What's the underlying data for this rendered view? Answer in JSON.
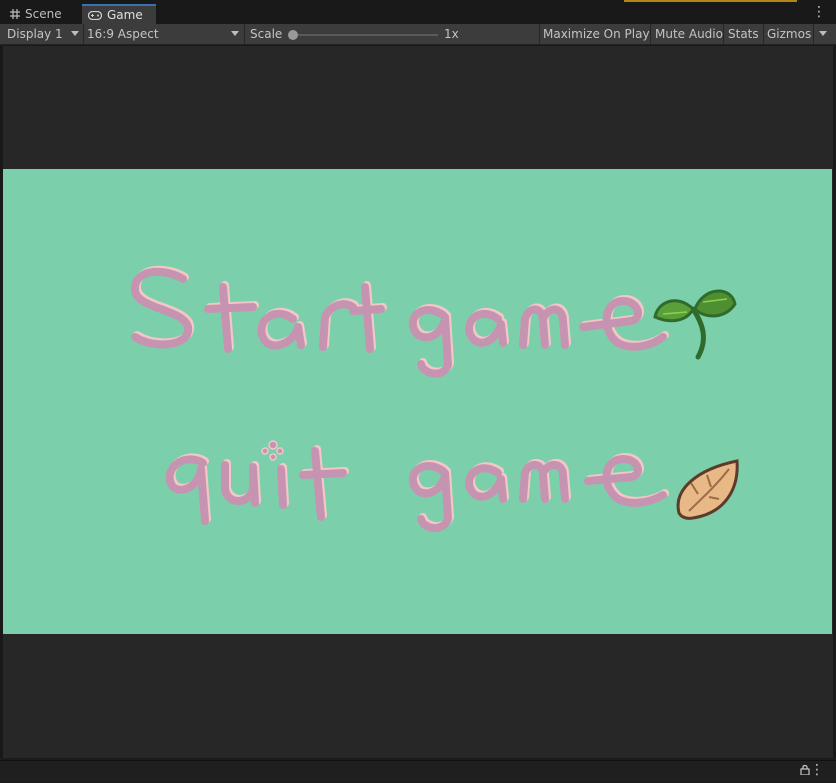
{
  "tabs": [
    {
      "label": "Scene",
      "icon": "grid-icon"
    },
    {
      "label": "Game",
      "icon": "gamepad-icon",
      "active": true
    }
  ],
  "toolbar": {
    "display": "Display 1",
    "aspect": "16:9 Aspect",
    "scale_label": "Scale",
    "scale_value": "1x",
    "scale_slider_fraction": 0.0,
    "maximize": "Maximize On Play",
    "mute": "Mute Audio",
    "stats": "Stats",
    "gizmos": "Gizmos"
  },
  "game": {
    "background": "#7ccfab",
    "start_label": "Start game",
    "quit_label": "quit game",
    "text_color": "#c694b0",
    "highlight_color": "#f3c7c7",
    "sprout_icon": "sprout-icon",
    "seed_icon": "seed-icon"
  }
}
